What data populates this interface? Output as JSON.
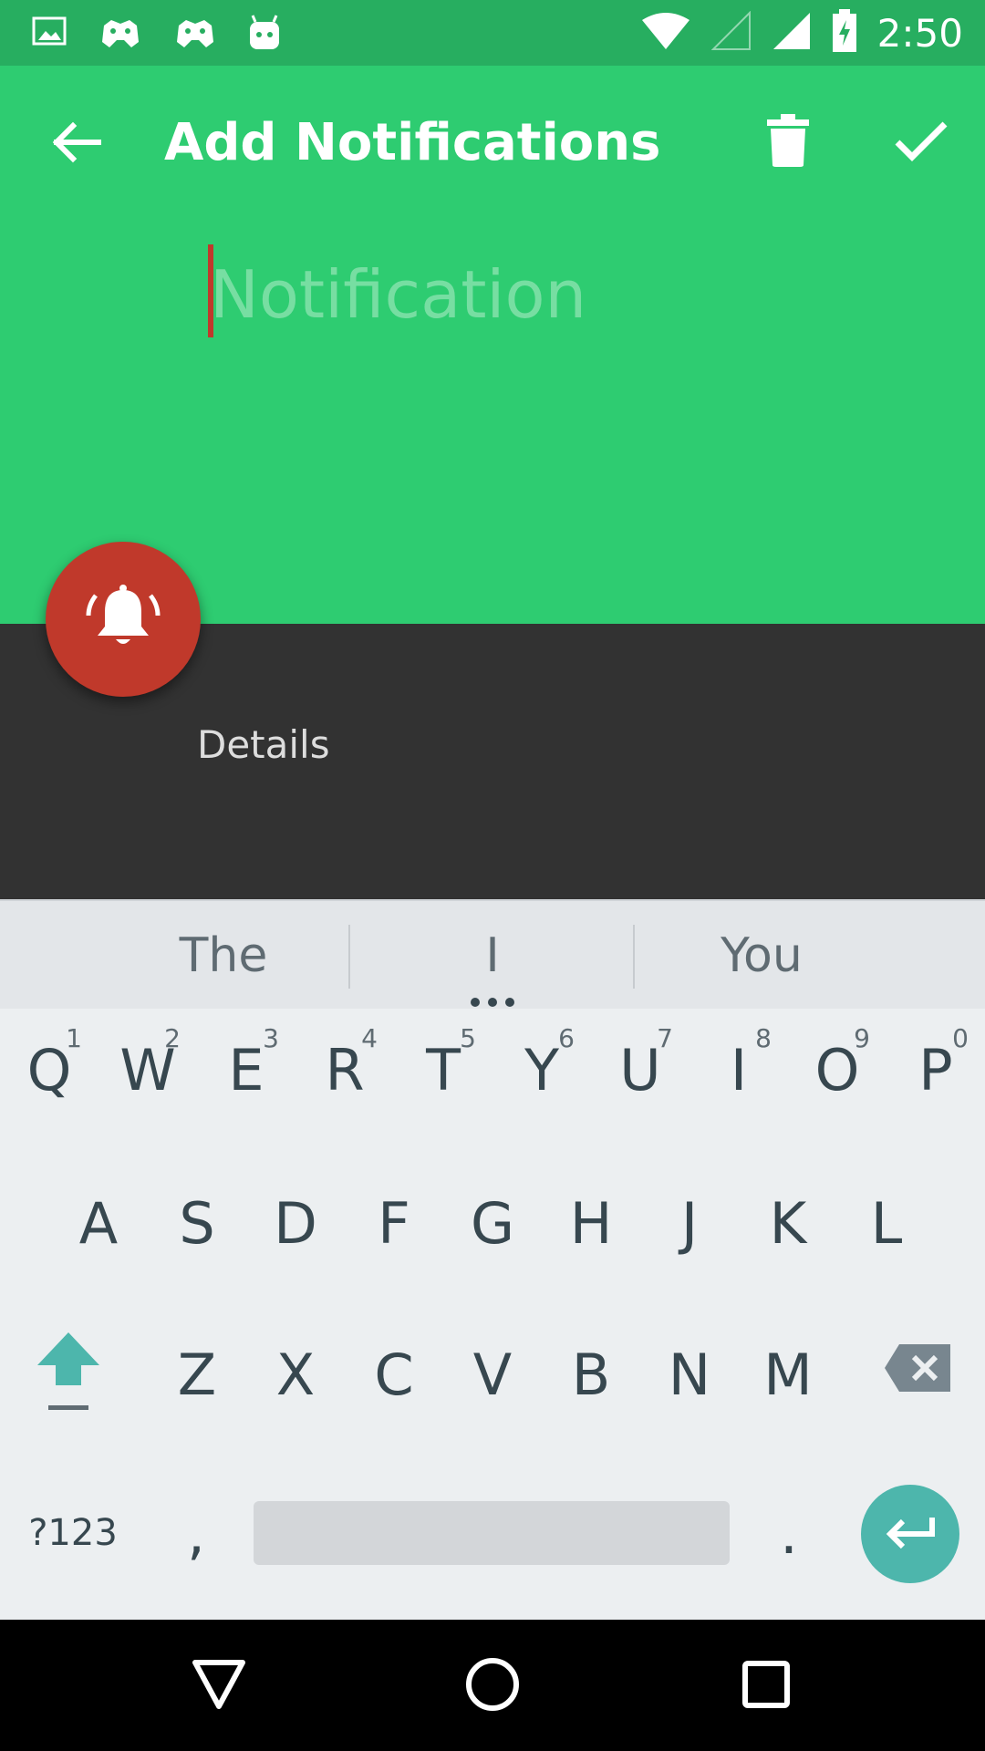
{
  "status_bar": {
    "time": "2:50",
    "icons": [
      "image-icon",
      "game-controller-icon",
      "game-controller-icon",
      "android-icon",
      "wifi-icon",
      "signal-empty-icon",
      "signal-full-icon",
      "battery-charging-icon"
    ]
  },
  "app_bar": {
    "title": "Add Notifications",
    "back_icon": "arrow-back-icon",
    "delete_icon": "trash-icon",
    "confirm_icon": "check-icon"
  },
  "notification_field": {
    "placeholder": "Notification",
    "value": ""
  },
  "fab": {
    "icon": "alarm-bell-icon"
  },
  "details": {
    "label": "Details"
  },
  "keyboard": {
    "suggestions": [
      "The",
      "I",
      "You"
    ],
    "row1": [
      {
        "key": "Q",
        "hint": "1"
      },
      {
        "key": "W",
        "hint": "2"
      },
      {
        "key": "E",
        "hint": "3"
      },
      {
        "key": "R",
        "hint": "4"
      },
      {
        "key": "T",
        "hint": "5"
      },
      {
        "key": "Y",
        "hint": "6"
      },
      {
        "key": "U",
        "hint": "7"
      },
      {
        "key": "I",
        "hint": "8"
      },
      {
        "key": "O",
        "hint": "9"
      },
      {
        "key": "P",
        "hint": "0"
      }
    ],
    "row2": [
      "A",
      "S",
      "D",
      "F",
      "G",
      "H",
      "J",
      "K",
      "L"
    ],
    "row3": [
      "Z",
      "X",
      "C",
      "V",
      "B",
      "N",
      "M"
    ],
    "symbols_label": "?123",
    "comma": ",",
    "period": ".",
    "shift_icon": "shift-icon",
    "backspace_icon": "backspace-icon",
    "enter_icon": "enter-icon"
  },
  "colors": {
    "primary": "#2ecc71",
    "primary_dark": "#27ae60",
    "accent": "#c0392b",
    "keyboard_accent": "#4db6ac"
  }
}
